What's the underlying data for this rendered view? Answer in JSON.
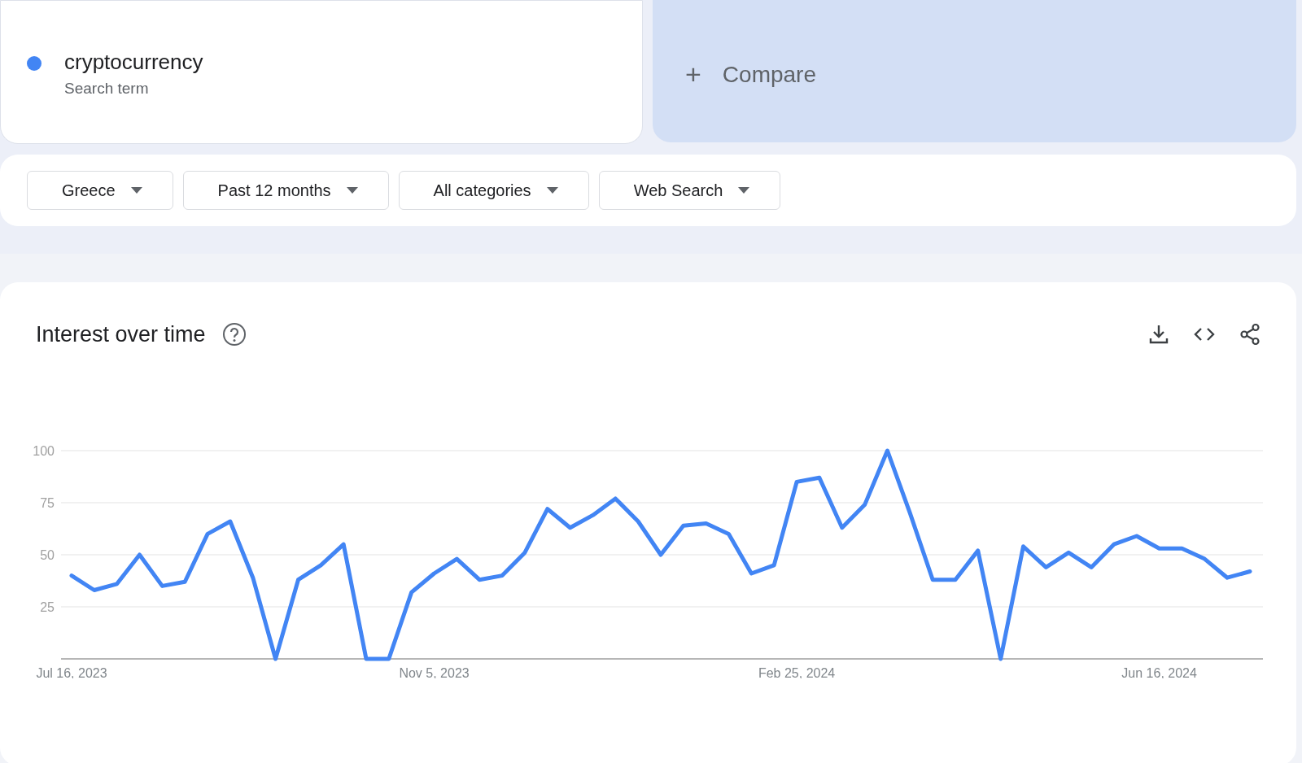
{
  "search_terms": [
    {
      "term": "cryptocurrency",
      "subtitle": "Search term",
      "color": "#4285f4"
    }
  ],
  "compare": {
    "icon": "+",
    "label": "Compare"
  },
  "filters": [
    {
      "label": "Greece"
    },
    {
      "label": "Past 12 months"
    },
    {
      "label": "All categories"
    },
    {
      "label": "Web Search"
    }
  ],
  "interest_over_time": {
    "title": "Interest over time",
    "chart_data": {
      "type": "line",
      "grid": true,
      "yticks": [
        25,
        50,
        75,
        100
      ],
      "ylim": [
        0,
        100
      ],
      "categories": [
        "Jul 16, 2023",
        null,
        null,
        null,
        null,
        null,
        null,
        null,
        null,
        null,
        null,
        null,
        null,
        null,
        null,
        null,
        "Nov 5, 2023",
        null,
        null,
        null,
        null,
        null,
        null,
        null,
        null,
        null,
        null,
        null,
        null,
        null,
        null,
        null,
        "Feb 25, 2024",
        null,
        null,
        null,
        null,
        null,
        null,
        null,
        null,
        null,
        null,
        null,
        null,
        null,
        null,
        null,
        "Jun 16, 2024",
        null,
        null,
        null,
        null
      ],
      "series": [
        {
          "color": "#4285f4",
          "values": [
            40,
            33,
            36,
            50,
            35,
            37,
            60,
            66,
            39,
            0,
            38,
            45,
            55,
            0,
            0,
            32,
            41,
            48,
            38,
            40,
            51,
            72,
            63,
            69,
            77,
            66,
            50,
            64,
            65,
            60,
            41,
            45,
            85,
            87,
            63,
            74,
            100,
            70,
            38,
            38,
            52,
            0,
            54,
            44,
            51,
            44,
            55,
            59,
            53,
            53,
            48,
            39,
            42
          ]
        }
      ]
    }
  }
}
